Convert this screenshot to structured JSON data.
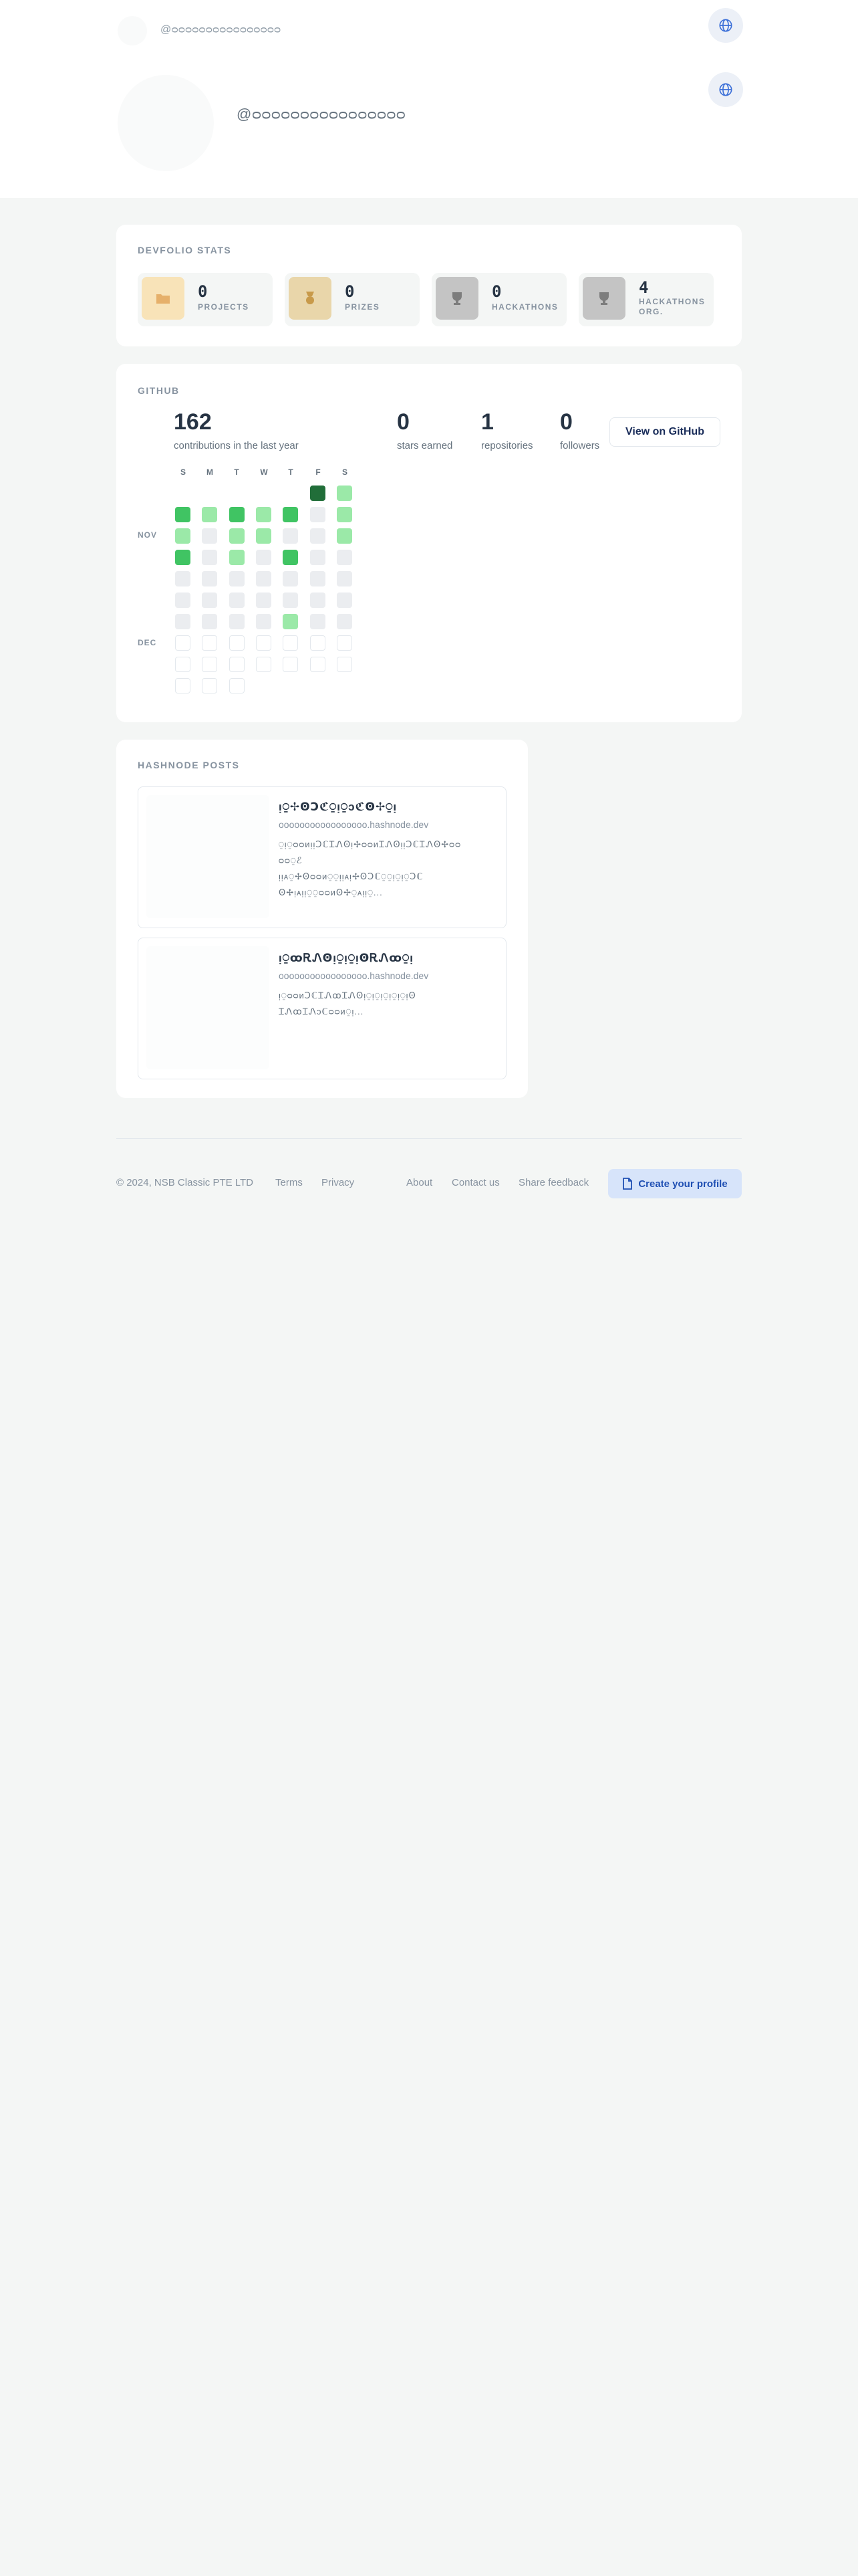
{
  "header": {
    "mini_handle": "@ᴑᴑᴑᴑᴑᴑᴑᴑᴑᴑᴑᴑᴑᴑᴑᴑ",
    "handle": "@ᴑᴑᴑᴑᴑᴑᴑᴑᴑᴑᴑᴑᴑᴑᴑᴑ",
    "globe_icon": "globe-icon"
  },
  "stats": {
    "title": "DEVFOLIO STATS",
    "items": [
      {
        "value": "0",
        "label": "PROJECTS",
        "icon": "folder-icon",
        "color": "#f8e3b8"
      },
      {
        "value": "0",
        "label": "PRIZES",
        "icon": "medal-icon",
        "color": "#e9d6aa"
      },
      {
        "value": "0",
        "label": "HACKATHONS",
        "icon": "trophy-icon",
        "color": "#c4c4c4"
      },
      {
        "value": "4",
        "label": "HACKATHONS ORG.",
        "icon": "trophy-icon",
        "color": "#c4c4c4"
      }
    ]
  },
  "github": {
    "title": "GITHUB",
    "contributions": "162",
    "contributions_label": "contributions in the last year",
    "stars": "0",
    "stars_label": "stars earned",
    "repos": "1",
    "repos_label": "repositories",
    "followers": "0",
    "followers_label": "followers",
    "button_label": "View on GitHub",
    "days": [
      "S",
      "M",
      "T",
      "W",
      "T",
      "F",
      "S"
    ],
    "months": [
      "NOV",
      "DEC"
    ],
    "heatmap": [
      [
        -1,
        -1,
        -1,
        -1,
        -1,
        4,
        1
      ],
      [
        3,
        1,
        3,
        1,
        3,
        0,
        1
      ],
      [
        1,
        0,
        1,
        1,
        0,
        0,
        1
      ],
      [
        3,
        0,
        1,
        0,
        3,
        0,
        0
      ],
      [
        0,
        0,
        0,
        0,
        0,
        0,
        0
      ],
      [
        0,
        0,
        0,
        0,
        0,
        0,
        0
      ],
      [
        0,
        0,
        0,
        0,
        1,
        0,
        0
      ],
      [
        -2,
        -2,
        -2,
        -2,
        -2,
        -2,
        -2
      ],
      [
        -2,
        -2,
        -2,
        -2,
        -2,
        -2,
        -2
      ],
      [
        -2,
        -2,
        -2,
        -1,
        -1,
        -1,
        -1
      ]
    ],
    "palette": [
      "#ebedf0",
      "#9be9a8",
      "#7fd38f",
      "#40c463",
      "#216e39"
    ]
  },
  "hashnode": {
    "title": "HASHNODE POSTS",
    "posts": [
      {
        "title": "ᴉ⍜✢ꙨↃℭ⍜ᴉ⍜ↄℭꙨ✢⍜ᴉ",
        "host": "ooooooooooooooooo.hashnode.dev",
        "body": [
          "⍜ᴉ⍜ᴑᴑᴎᴉᴉↃℂᏆᏁꙨᴉ✢ᴑᴑᴎᏆᏁꙨᴉᴉↃℂᏆᏁꙨ✢ᴑᴑ",
          "ᴑᴑ⍜ℰ",
          "ᴉᴉᴀ⍜✢Ꙩᴑᴑᴎ⍜⍜ᴉᴉᴀᴉ✢ꙨↃℂ⍜⍜ᴉ⍜ᴉ⍜Ↄℂ",
          "Ꙩ✢ᴉᴀᴉᴉ⍜⍜ᴑᴑᴎꙨ✢⍜ᴀᴉᴉ⍜..."
        ]
      },
      {
        "title": "ᴉ⍜ꚙᎡᏁꙨᴉ⍜ᴉ⍜ᴉꙨᎡᏁꚙ⍜ᴉ",
        "host": "ooooooooooooooooo.hashnode.dev",
        "body": [
          "ᴉ⍜ᴑᴑᴎↃℂᏆᏁꚙᏆᏁꙨᴉ⍜ᴉ⍜ᴉ⍜ᴉ⍜ᴉ⍜ᴉꙨ",
          "ᏆᏁꚙᏆᏁↄℂᴑᴑᴎ⍜ᴉ..."
        ]
      }
    ]
  },
  "footer": {
    "copyright": "© 2024, NSB Classic PTE LTD",
    "terms": "Terms",
    "privacy": "Privacy",
    "about": "About",
    "contact": "Contact us",
    "feedback": "Share feedback",
    "create_profile": "Create your profile"
  }
}
